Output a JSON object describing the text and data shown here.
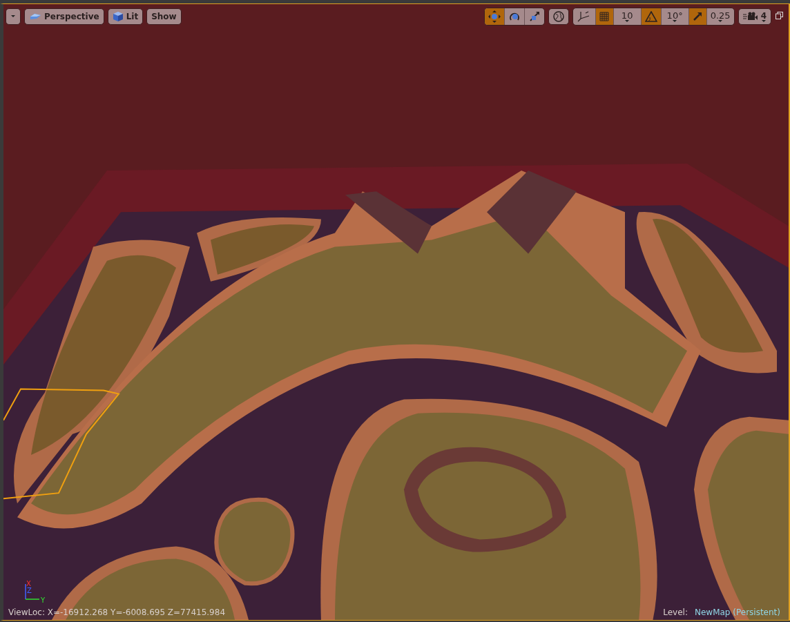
{
  "viewport": {
    "left_buttons": [
      {
        "kind": "dropdown"
      },
      {
        "kind": "perspective",
        "label": "Perspective"
      },
      {
        "kind": "lit",
        "label": "Lit"
      },
      {
        "kind": "plain",
        "label": "Show"
      }
    ],
    "transform_tools": [
      {
        "kind": "move",
        "selected": true
      },
      {
        "kind": "rotate",
        "selected": false
      },
      {
        "kind": "scale",
        "selected": false
      }
    ],
    "surface_snapping": {
      "on": false
    },
    "snaps": [
      {
        "kind": "grid",
        "on": true,
        "value": "10"
      },
      {
        "kind": "angle",
        "on": true,
        "value": "10°"
      },
      {
        "kind": "scale",
        "on": true,
        "value": "0.25"
      }
    ],
    "camera_speed": "4",
    "gizmo": {
      "x": "X",
      "z": "Z",
      "y": "Y"
    },
    "view_location": "ViewLoc: X=-16912.268 Y=-6008.695 Z=77415.984",
    "level": {
      "label": "Level:",
      "name": "NewMap (Persistent)"
    }
  }
}
